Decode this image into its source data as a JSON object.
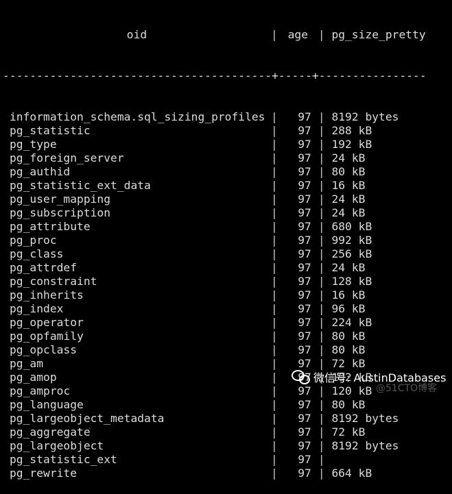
{
  "table": {
    "headers": [
      "oid",
      "age",
      "pg_size_pretty"
    ],
    "divider": "----------------------------------------+-----+----------------",
    "column_separator": "|",
    "rows": [
      {
        "oid": "information_schema.sql_sizing_profiles",
        "age": "97",
        "size": "8192 bytes"
      },
      {
        "oid": "pg_statistic",
        "age": "97",
        "size": "288 kB"
      },
      {
        "oid": "pg_type",
        "age": "97",
        "size": "192 kB"
      },
      {
        "oid": "pg_foreign_server",
        "age": "97",
        "size": "24 kB"
      },
      {
        "oid": "pg_authid",
        "age": "97",
        "size": "80 kB"
      },
      {
        "oid": "pg_statistic_ext_data",
        "age": "97",
        "size": "16 kB"
      },
      {
        "oid": "pg_user_mapping",
        "age": "97",
        "size": "24 kB"
      },
      {
        "oid": "pg_subscription",
        "age": "97",
        "size": "24 kB"
      },
      {
        "oid": "pg_attribute",
        "age": "97",
        "size": "680 kB"
      },
      {
        "oid": "pg_proc",
        "age": "97",
        "size": "992 kB"
      },
      {
        "oid": "pg_class",
        "age": "97",
        "size": "256 kB"
      },
      {
        "oid": "pg_attrdef",
        "age": "97",
        "size": "24 kB"
      },
      {
        "oid": "pg_constraint",
        "age": "97",
        "size": "128 kB"
      },
      {
        "oid": "pg_inherits",
        "age": "97",
        "size": "16 kB"
      },
      {
        "oid": "pg_index",
        "age": "97",
        "size": "96 kB"
      },
      {
        "oid": "pg_operator",
        "age": "97",
        "size": "224 kB"
      },
      {
        "oid": "pg_opfamily",
        "age": "97",
        "size": "80 kB"
      },
      {
        "oid": "pg_opclass",
        "age": "97",
        "size": "80 kB"
      },
      {
        "oid": "pg_am",
        "age": "97",
        "size": "72 kB"
      },
      {
        "oid": "pg_amop",
        "age": "97",
        "size": "192 kB"
      },
      {
        "oid": "pg_amproc",
        "age": "97",
        "size": "120 kB"
      },
      {
        "oid": "pg_language",
        "age": "97",
        "size": "80 kB"
      },
      {
        "oid": "pg_largeobject_metadata",
        "age": "97",
        "size": "8192 bytes"
      },
      {
        "oid": "pg_aggregate",
        "age": "97",
        "size": "72 kB"
      },
      {
        "oid": "pg_largeobject",
        "age": "97",
        "size": "8192 bytes"
      },
      {
        "oid": "pg_statistic_ext",
        "age": "97",
        "size": ""
      },
      {
        "oid": "pg_rewrite",
        "age": "97",
        "size": "664 kB"
      }
    ]
  },
  "watermark": {
    "icon": "wechat-icon",
    "text": "微信号: AustinDatabases",
    "source": "@51CTO博客"
  }
}
